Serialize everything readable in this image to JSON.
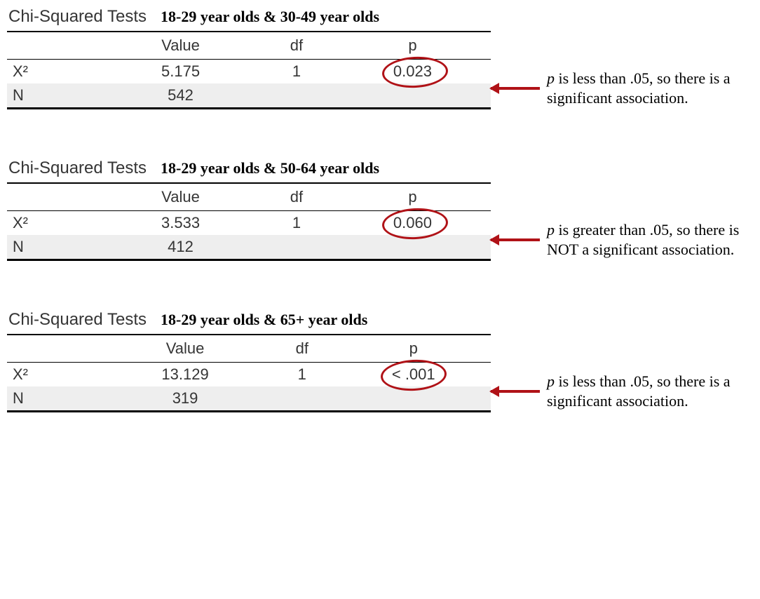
{
  "common": {
    "title": "Chi-Squared Tests",
    "col_value": "Value",
    "col_df": "df",
    "col_p": "p",
    "row_x2": "X²",
    "row_n": "N"
  },
  "blocks": [
    {
      "subtitle": "18-29 year olds & 30-49 year olds",
      "value": "5.175",
      "df": "1",
      "p": "0.023",
      "n": "542",
      "annotation_lead": "p",
      "annotation_rest": " is less than .05, so there is a significant association."
    },
    {
      "subtitle": "18-29 year olds & 50-64 year olds",
      "value": "3.533",
      "df": "1",
      "p": "0.060",
      "n": "412",
      "annotation_lead": "p",
      "annotation_rest": " is greater than .05, so there is NOT a significant association."
    },
    {
      "subtitle": "18-29 year olds & 65+ year olds",
      "value": "13.129",
      "df": "1",
      "p": "< .001",
      "n": "319",
      "annotation_lead": "p",
      "annotation_rest": " is less than .05, so there is a significant association."
    }
  ],
  "chart_data": [
    {
      "type": "table",
      "title": "Chi-Squared Tests: 18-29 year olds & 30-49 year olds",
      "columns": [
        "",
        "Value",
        "df",
        "p"
      ],
      "rows": [
        [
          "X²",
          5.175,
          1,
          0.023
        ],
        [
          "N",
          542,
          null,
          null
        ]
      ]
    },
    {
      "type": "table",
      "title": "Chi-Squared Tests: 18-29 year olds & 50-64 year olds",
      "columns": [
        "",
        "Value",
        "df",
        "p"
      ],
      "rows": [
        [
          "X²",
          3.533,
          1,
          0.06
        ],
        [
          "N",
          412,
          null,
          null
        ]
      ]
    },
    {
      "type": "table",
      "title": "Chi-Squared Tests: 18-29 year olds & 65+ year olds",
      "columns": [
        "",
        "Value",
        "df",
        "p"
      ],
      "rows": [
        [
          "X²",
          13.129,
          1,
          "< .001"
        ],
        [
          "N",
          319,
          null,
          null
        ]
      ]
    }
  ]
}
